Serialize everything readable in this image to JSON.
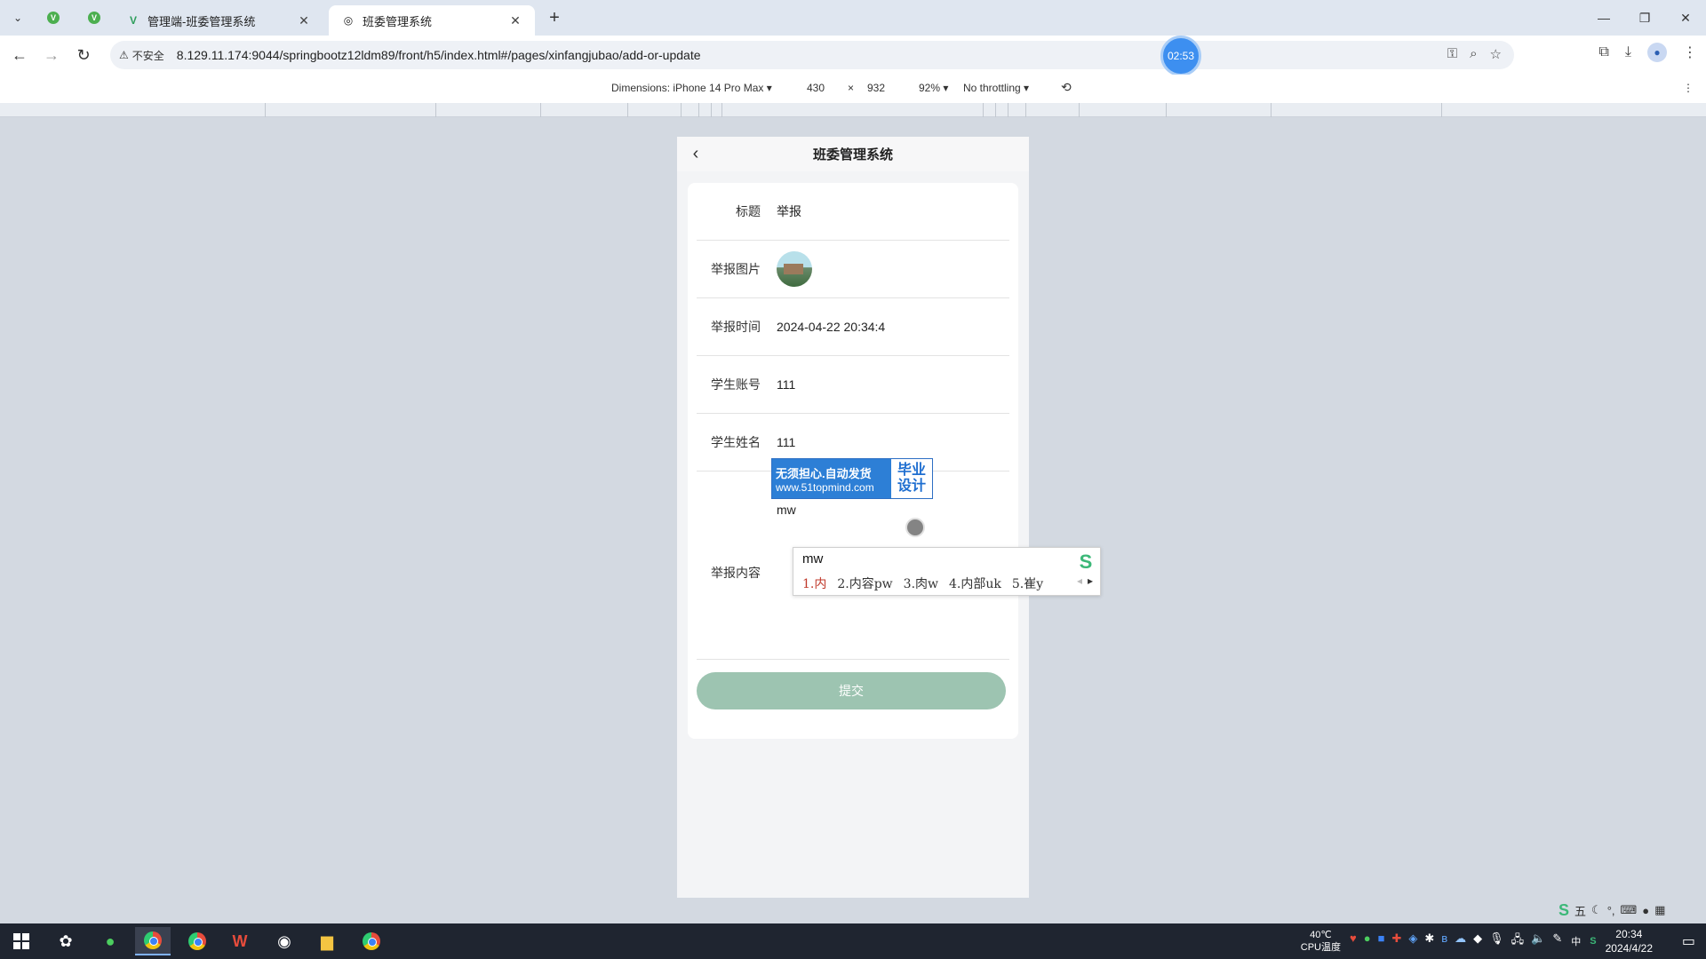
{
  "browser": {
    "tabs": [
      {
        "title": "管理端-班委管理系统",
        "active": false
      },
      {
        "title": "班委管理系统",
        "active": true
      }
    ],
    "security_label": "不安全",
    "url": "8.129.11.174:9044/springbootz12ldm89/front/h5/index.html#/pages/xinfangjubao/add-or-update",
    "timer": "02:53"
  },
  "devtools": {
    "dimensions_label": "Dimensions: iPhone 14 Pro Max",
    "width": "430",
    "times": "×",
    "height": "932",
    "zoom": "92%",
    "throttle": "No throttling"
  },
  "app": {
    "title": "班委管理系统",
    "fields": [
      {
        "label": "标题",
        "value": "举报"
      },
      {
        "label": "举报图片",
        "value": ""
      },
      {
        "label": "举报时间",
        "value": "2024-04-22 20:34:4"
      },
      {
        "label": "学生账号",
        "value": "111"
      },
      {
        "label": "学生姓名",
        "value": "111"
      }
    ],
    "content_label": "举报内容",
    "content_value": "mw",
    "submit_label": "提交"
  },
  "watermark": {
    "line1": "无须担心.自动发货",
    "line2": "www.51topmind.com",
    "right1": "毕业",
    "right2": "设计"
  },
  "ime": {
    "input": "mw",
    "candidates": [
      "1.内",
      "2.内容pw",
      "3.肉w",
      "4.内部uk",
      "5.崔y"
    ],
    "status": "五"
  },
  "taskbar": {
    "temp": "40℃",
    "temp_label": "CPU温度",
    "lang": "中",
    "time": "20:34",
    "date": "2024/4/22"
  }
}
